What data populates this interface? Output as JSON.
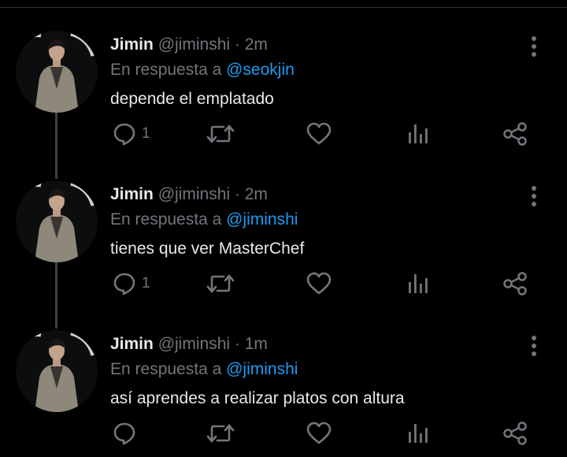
{
  "tweets": [
    {
      "name": "Jimin",
      "handle": "@jiminshi",
      "separator": "·",
      "time": "2m",
      "reply_prefix": "En respuesta a",
      "reply_to": "@seokjin",
      "text": "depende el emplatado",
      "reply_count": "1",
      "retweet_count": "",
      "like_count": ""
    },
    {
      "name": "Jimin",
      "handle": "@jiminshi",
      "separator": "·",
      "time": "2m",
      "reply_prefix": "En respuesta a",
      "reply_to": "@jiminshi",
      "text": "tienes que ver MasterChef",
      "reply_count": "1",
      "retweet_count": "",
      "like_count": ""
    },
    {
      "name": "Jimin",
      "handle": "@jiminshi",
      "separator": "·",
      "time": "1m",
      "reply_prefix": "En respuesta a",
      "reply_to": "@jiminshi",
      "text": "así aprendes a realizar platos con altura",
      "reply_count": "",
      "retweet_count": "",
      "like_count": ""
    }
  ],
  "icons": {
    "reply": "reply-icon",
    "retweet": "retweet-icon",
    "like": "heart-icon",
    "analytics": "analytics-icon",
    "share": "share-icon",
    "more": "more-options-icon"
  },
  "colors": {
    "background": "#000000",
    "primary_text": "#e7e9ea",
    "secondary_text": "#71767b",
    "mention": "#1d9bf0",
    "thread_line": "#3e4144"
  }
}
